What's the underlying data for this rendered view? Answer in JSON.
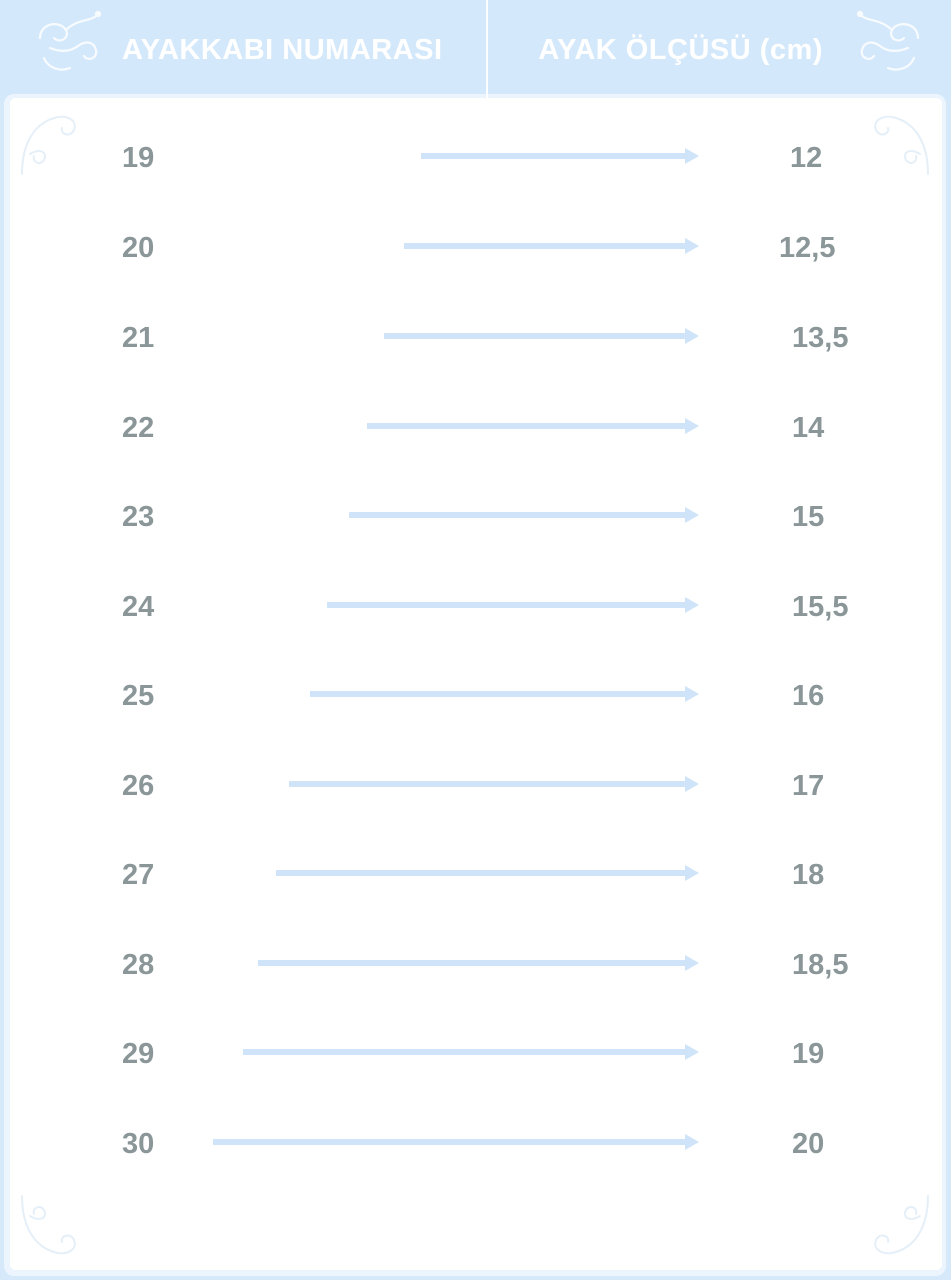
{
  "header": {
    "left_title": "AYAKKABI NUMARASI",
    "right_title": "AYAK ÖLÇÜSÜ (cm)"
  },
  "rows": [
    {
      "shoe_size": "19",
      "foot_length": "12"
    },
    {
      "shoe_size": "20",
      "foot_length": "12,5"
    },
    {
      "shoe_size": "21",
      "foot_length": "13,5"
    },
    {
      "shoe_size": "22",
      "foot_length": "14"
    },
    {
      "shoe_size": "23",
      "foot_length": "15"
    },
    {
      "shoe_size": "24",
      "foot_length": "15,5"
    },
    {
      "shoe_size": "25",
      "foot_length": "16"
    },
    {
      "shoe_size": "26",
      "foot_length": "17"
    },
    {
      "shoe_size": "27",
      "foot_length": "18"
    },
    {
      "shoe_size": "28",
      "foot_length": "18,5"
    },
    {
      "shoe_size": "29",
      "foot_length": "19"
    },
    {
      "shoe_size": "30",
      "foot_length": "20"
    }
  ],
  "colors": {
    "background_blue": "#d6e9fa",
    "number_gray": "#8a9698",
    "arrow_blue": "#cfe4f8",
    "paper_white": "#ffffff"
  },
  "icons": {
    "corner": "swirl-ornament-icon",
    "row_connector": "arrow-right-icon"
  }
}
